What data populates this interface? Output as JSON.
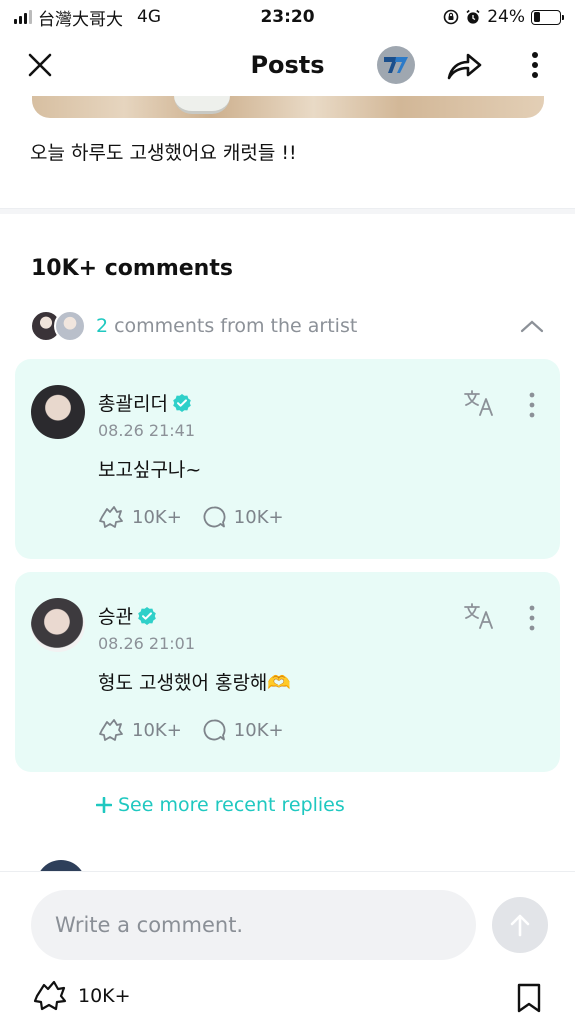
{
  "status_bar": {
    "carrier": "台灣大哥大",
    "network": "4G",
    "time": "23:20",
    "battery": "24%",
    "battery_level": 0.24
  },
  "nav": {
    "title": "Posts",
    "icons": [
      "close-icon",
      "artist-logo-icon",
      "share-icon",
      "more-vertical-icon"
    ]
  },
  "post": {
    "text": "오늘 하루도 고생했어요 캐럿들 !!"
  },
  "comments": {
    "heading": "10K+ comments",
    "artist_summary": {
      "count": "2",
      "label": "comments from the artist"
    },
    "items": [
      {
        "author": "총괄리더",
        "date": "08.26 21:41",
        "text": "보고싶구나~",
        "likes": "10K+",
        "replies": "10K+"
      },
      {
        "author": "승관",
        "date": "08.26 21:01",
        "text": "형도 고생했어 홍랑해🫶",
        "likes": "10K+",
        "replies": "10K+"
      }
    ],
    "see_more": "See more recent replies"
  },
  "bottom_bar": {
    "input_placeholder": "Write a comment.",
    "likes": "10K+"
  },
  "colors": {
    "accent": "#1fc8c0",
    "card_background": "#e8fbf7",
    "verified": "#2fd0c9",
    "muted_text": "#8c9198"
  }
}
